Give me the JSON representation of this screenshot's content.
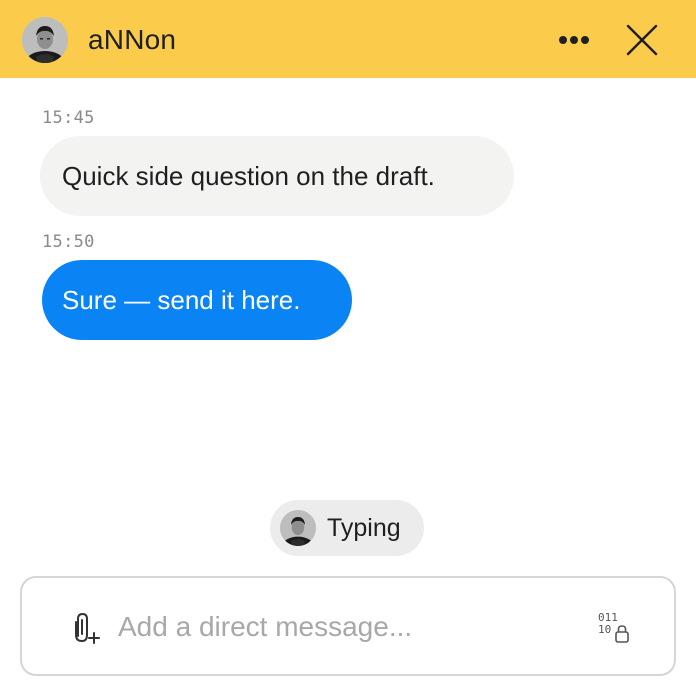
{
  "header": {
    "title": "aNNon",
    "background_color": "#fbcb4c",
    "avatar_icon": "user-avatar-icon",
    "more_icon": "more-horizontal-icon",
    "close_icon": "close-icon"
  },
  "messages": [
    {
      "timestamp": "15:45",
      "text": "Quick side question on the draft.",
      "direction": "incoming",
      "bubble_color": "#f3f3f2"
    },
    {
      "timestamp": "15:50",
      "text": "Sure — send it here.",
      "direction": "outgoing",
      "bubble_color": "#0a84f4"
    }
  ],
  "typing_indicator": {
    "label": "Typing"
  },
  "composer": {
    "placeholder": "Add a direct message...",
    "value": "",
    "attach_icon": "attach-paperclip-plus-icon",
    "encrypt_icon": "binary-lock-icon"
  }
}
